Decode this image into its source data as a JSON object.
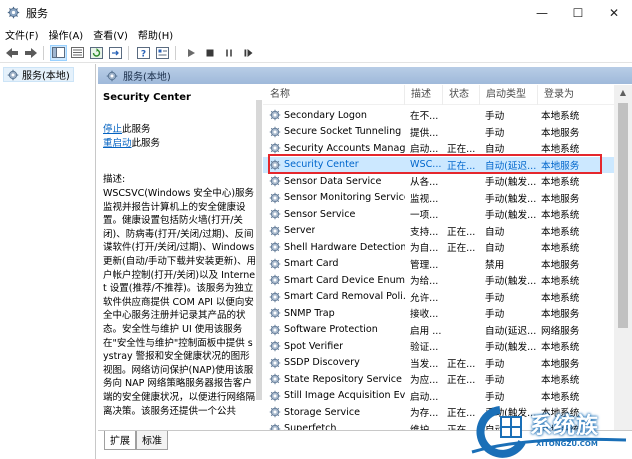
{
  "window": {
    "title": "服务",
    "minimize_glyph": "—",
    "maximize_glyph": "☐",
    "close_glyph": "✕"
  },
  "menu": [
    "文件(F)",
    "操作(A)",
    "查看(V)",
    "帮助(H)"
  ],
  "tree": {
    "root_label": "服务(本地)"
  },
  "right_header": {
    "label": "服务(本地)"
  },
  "desc": {
    "title": "Security Center",
    "stop_link": "停止",
    "stop_suffix": "此服务",
    "restart_link": "重启动",
    "restart_suffix": "此服务",
    "label": "描述:",
    "body": "WSCSVC(Windows 安全中心)服务监视并报告计算机上的安全健康设置。健康设置包括防火墙(打开/关闭)、防病毒(打开/关闭/过期)、反间谍软件(打开/关闭/过期)、Windows 更新(自动/手动下载并安装更新)、用户帐户控制(打开/关闭)以及 Internet 设置(推荐/不推荐)。该服务为独立软件供应商提供 COM API 以便向安全中心服务注册并记录其产品的状态。安全性与维护 UI 使用该服务在\"安全性与维护\"控制面板中提供 systray 警报和安全健康状况的图形视图。网络访问保护(NAP)使用该服务向 NAP 网络策略服务器报告客户端的安全健康状况，以便进行网络隔离决策。该服务还提供一个公共"
  },
  "columns": {
    "name": "名称",
    "desc": "描述",
    "status": "状态",
    "startup": "启动类型",
    "logon": "登录为"
  },
  "services": [
    {
      "name": "Secondary Logon",
      "desc": "在不...",
      "status": "",
      "startup": "手动",
      "logon": "本地系统",
      "selected": false
    },
    {
      "name": "Secure Socket Tunneling ...",
      "desc": "提供...",
      "status": "",
      "startup": "手动",
      "logon": "本地服务",
      "selected": false
    },
    {
      "name": "Security Accounts Manag...",
      "desc": "启动...",
      "status": "正在...",
      "startup": "自动",
      "logon": "本地系统",
      "selected": false
    },
    {
      "name": "Security Center",
      "desc": "WSC...",
      "status": "正在...",
      "startup": "自动(延迟...",
      "logon": "本地服务",
      "selected": true
    },
    {
      "name": "Sensor Data Service",
      "desc": "从各...",
      "status": "",
      "startup": "手动(触发...",
      "logon": "本地系统",
      "selected": false
    },
    {
      "name": "Sensor Monitoring Service",
      "desc": "监视...",
      "status": "",
      "startup": "手动(触发...",
      "logon": "本地服务",
      "selected": false
    },
    {
      "name": "Sensor Service",
      "desc": "一项...",
      "status": "",
      "startup": "手动(触发...",
      "logon": "本地系统",
      "selected": false
    },
    {
      "name": "Server",
      "desc": "支持...",
      "status": "正在...",
      "startup": "自动",
      "logon": "本地系统",
      "selected": false
    },
    {
      "name": "Shell Hardware Detection",
      "desc": "为自...",
      "status": "正在...",
      "startup": "自动",
      "logon": "本地系统",
      "selected": false
    },
    {
      "name": "Smart Card",
      "desc": "管理...",
      "status": "",
      "startup": "禁用",
      "logon": "本地服务",
      "selected": false
    },
    {
      "name": "Smart Card Device Enum...",
      "desc": "为给...",
      "status": "",
      "startup": "手动(触发...",
      "logon": "本地系统",
      "selected": false
    },
    {
      "name": "Smart Card Removal Poli...",
      "desc": "允许...",
      "status": "",
      "startup": "手动",
      "logon": "本地系统",
      "selected": false
    },
    {
      "name": "SNMP Trap",
      "desc": "接收...",
      "status": "",
      "startup": "手动",
      "logon": "本地服务",
      "selected": false
    },
    {
      "name": "Software Protection",
      "desc": "启用 ...",
      "status": "",
      "startup": "自动(延迟...",
      "logon": "网络服务",
      "selected": false
    },
    {
      "name": "Spot Verifier",
      "desc": "验证...",
      "status": "",
      "startup": "手动(触发...",
      "logon": "本地系统",
      "selected": false
    },
    {
      "name": "SSDP Discovery",
      "desc": "当发...",
      "status": "正在...",
      "startup": "手动",
      "logon": "本地服务",
      "selected": false
    },
    {
      "name": "State Repository Service",
      "desc": "为应...",
      "status": "正在...",
      "startup": "手动",
      "logon": "本地系统",
      "selected": false
    },
    {
      "name": "Still Image Acquisition Ev...",
      "desc": "启动...",
      "status": "",
      "startup": "手动",
      "logon": "本地系统",
      "selected": false
    },
    {
      "name": "Storage Service",
      "desc": "为存...",
      "status": "正在...",
      "startup": "手动(触发...",
      "logon": "本地系统",
      "selected": false
    },
    {
      "name": "Superfetch",
      "desc": "维护...",
      "status": "正在...",
      "startup": "自动",
      "logon": "本地系统",
      "selected": false
    }
  ],
  "tabs": [
    "扩展",
    "标准"
  ],
  "watermark": {
    "text": "系统族",
    "url": "XITONGZU.COM"
  },
  "colors": {
    "accent": "#0078d7",
    "selection": "#cce8ff",
    "highlight_box": "#e5272d",
    "header_band": "#b8cde6"
  },
  "icons": {
    "app": "services-gear-icon",
    "service": "gear-icon",
    "toolbar": [
      "back-arrow-icon",
      "forward-arrow-icon",
      "console-tree-icon",
      "properties-list-icon",
      "refresh-icon",
      "export-list-icon",
      "help-icon",
      "properties-icon",
      "start-icon",
      "stop-icon",
      "pause-icon",
      "restart-icon"
    ]
  }
}
